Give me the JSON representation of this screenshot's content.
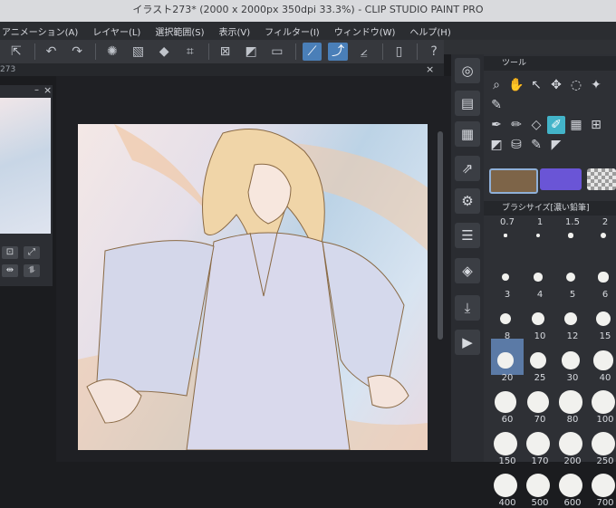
{
  "app": {
    "title": "イラスト273* (2000 x 2000px 350dpi 33.3%) - CLIP STUDIO PAINT PRO"
  },
  "menu": {
    "items": [
      "アニメーション(A)",
      "レイヤー(L)",
      "選択範囲(S)",
      "表示(V)",
      "フィルター(I)",
      "ウィンドウ(W)",
      "ヘルプ(H)"
    ]
  },
  "navigator": {
    "tab_label": "273",
    "close_glyph": "×",
    "minimize_glyph": "–"
  },
  "tool_panel": {
    "title": "ツール",
    "brush_size_title": "ブラシサイズ[濃い鉛筆]"
  },
  "brush_sizes": [
    {
      "label": "0.7",
      "size": 0.7
    },
    {
      "label": "1",
      "size": 1
    },
    {
      "label": "1.5",
      "size": 1.5
    },
    {
      "label": "2",
      "size": 2
    },
    {
      "label": "3",
      "size": 3
    },
    {
      "label": "4",
      "size": 4
    },
    {
      "label": "5",
      "size": 5
    },
    {
      "label": "6",
      "size": 6
    },
    {
      "label": "8",
      "size": 8
    },
    {
      "label": "10",
      "size": 10
    },
    {
      "label": "12",
      "size": 12
    },
    {
      "label": "15",
      "size": 15
    },
    {
      "label": "20",
      "size": 20
    },
    {
      "label": "25",
      "size": 25
    },
    {
      "label": "30",
      "size": 30
    },
    {
      "label": "40",
      "size": 40
    },
    {
      "label": "60",
      "size": 60
    },
    {
      "label": "70",
      "size": 70
    },
    {
      "label": "80",
      "size": 80
    },
    {
      "label": "100",
      "size": 100
    },
    {
      "label": "150",
      "size": 150
    },
    {
      "label": "170",
      "size": 170
    },
    {
      "label": "200",
      "size": 200
    },
    {
      "label": "250",
      "size": 250
    },
    {
      "label": "400",
      "size": 400
    },
    {
      "label": "500",
      "size": 500
    },
    {
      "label": "600",
      "size": 600
    },
    {
      "label": "700",
      "size": 700
    }
  ],
  "selected_brush_size": "8",
  "colors": {
    "main_color": "#7d6448",
    "sub_color": "#6a55d6",
    "accent": "#43b4c9",
    "active_tool_bg": "#4a7fb8"
  }
}
